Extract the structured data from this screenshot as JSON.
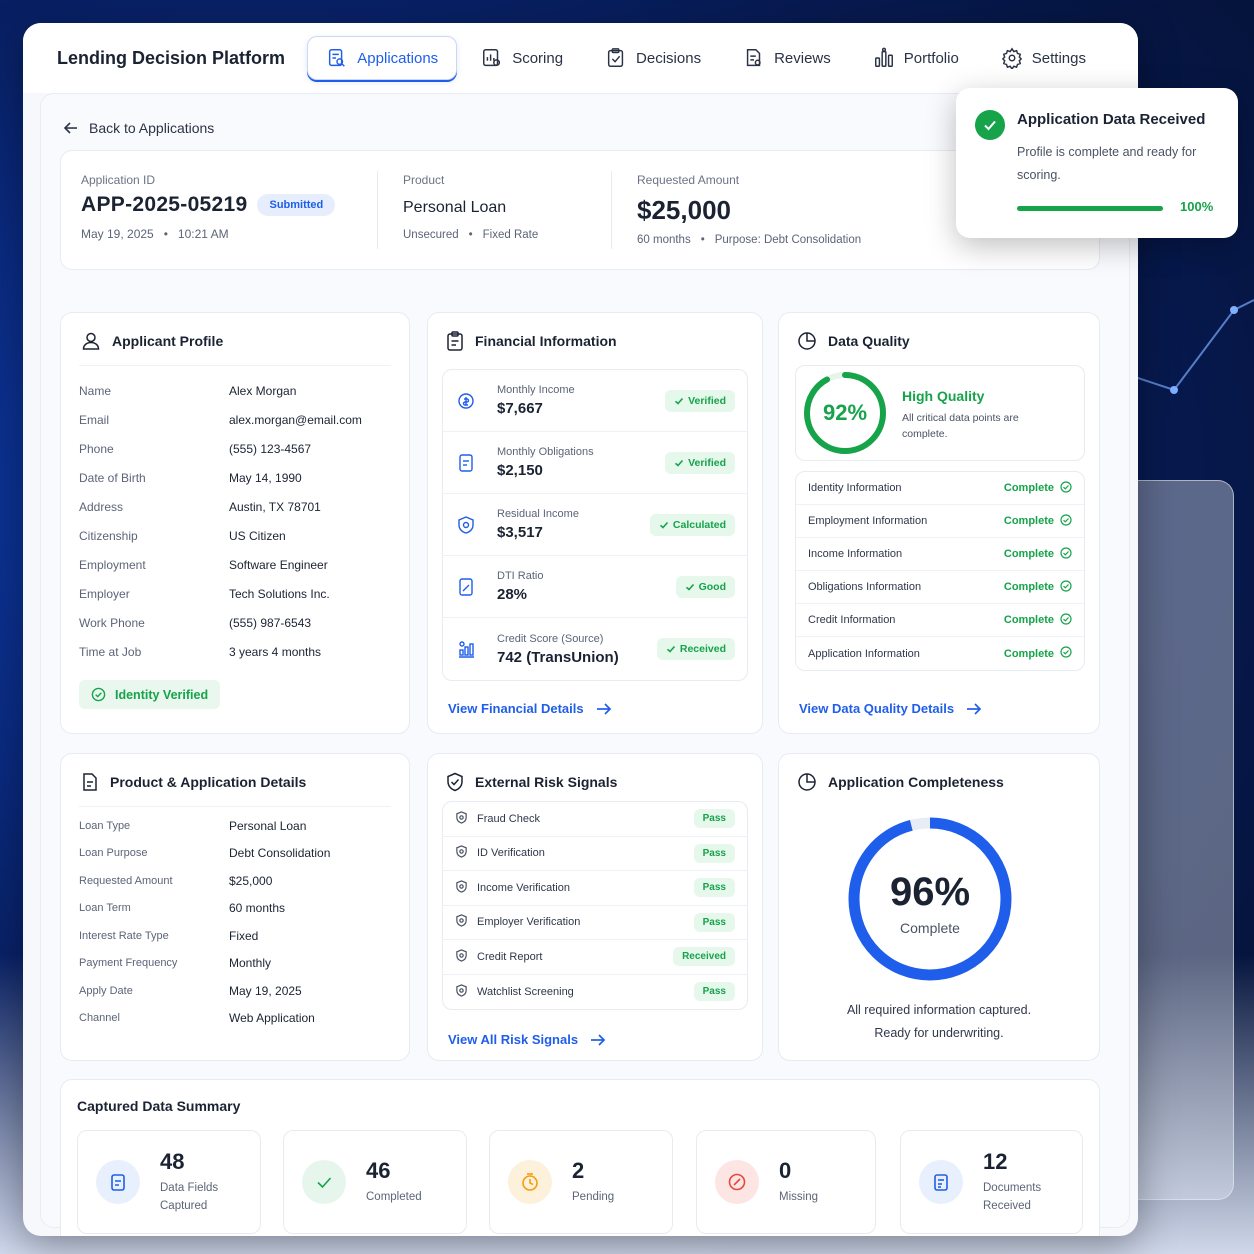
{
  "app": {
    "brand": "Lending Decision Platform",
    "nav": [
      {
        "label": "Applications",
        "icon": "applications-icon",
        "active": true
      },
      {
        "label": "Scoring",
        "icon": "scoring-icon"
      },
      {
        "label": "Decisions",
        "icon": "decisions-icon"
      },
      {
        "label": "Reviews",
        "icon": "reviews-icon"
      },
      {
        "label": "Portfolio",
        "icon": "portfolio-icon"
      },
      {
        "label": "Settings",
        "icon": "gear-icon"
      }
    ],
    "back_label": "Back to Applications"
  },
  "header": {
    "app_id_label": "Application ID",
    "app_id": "APP-2025-05219",
    "status": "Submitted",
    "date": "May 19, 2025",
    "time": "10:21 AM",
    "product_label": "Product",
    "product": "Personal Loan",
    "product_tag1": "Unsecured",
    "product_tag2": "Fixed Rate",
    "amount_label": "Requested Amount",
    "amount": "$25,000",
    "term": "60 months",
    "purpose": "Purpose: Debt Consolidation"
  },
  "toast": {
    "title": "Application Data Received",
    "message": "Profile is complete and ready for scoring.",
    "progress_percent": 100,
    "progress_label": "100%"
  },
  "applicant": {
    "title": "Applicant Profile",
    "rows": [
      {
        "k": "Name",
        "v": "Alex Morgan"
      },
      {
        "k": "Email",
        "v": "alex.morgan@email.com"
      },
      {
        "k": "Phone",
        "v": "(555) 123-4567"
      },
      {
        "k": "Date of Birth",
        "v": "May 14, 1990"
      },
      {
        "k": "Address",
        "v": "Austin, TX 78701"
      },
      {
        "k": "Citizenship",
        "v": "US Citizen"
      },
      {
        "k": "Employment",
        "v": "Software Engineer"
      },
      {
        "k": "Employer",
        "v": "Tech Solutions Inc."
      },
      {
        "k": "Work Phone",
        "v": "(555) 987-6543"
      },
      {
        "k": "Time at Job",
        "v": "3 years 4 months"
      }
    ],
    "badge": "Identity Verified"
  },
  "financial": {
    "title": "Financial Information",
    "rows": [
      {
        "label": "Monthly Income",
        "value": "$7,667",
        "status": "Verified",
        "icon": "income-icon"
      },
      {
        "label": "Monthly Obligations",
        "value": "$2,150",
        "status": "Verified",
        "icon": "obligations-icon"
      },
      {
        "label": "Residual Income",
        "value": "$3,517",
        "status": "Calculated",
        "icon": "residual-icon"
      },
      {
        "label": "DTI Ratio",
        "value": "28%",
        "status": "Good",
        "icon": "dti-icon"
      },
      {
        "label": "Credit Score (Source)",
        "value": "742 (TransUnion)",
        "status": "Received",
        "icon": "credit-score-icon"
      }
    ],
    "link": "View Financial Details"
  },
  "quality": {
    "title": "Data Quality",
    "score_label": "92%",
    "score_value": 92,
    "heading": "High Quality",
    "desc": "All critical data points are complete.",
    "rows": [
      {
        "label": "Identity Information",
        "status": "Complete"
      },
      {
        "label": "Employment Information",
        "status": "Complete"
      },
      {
        "label": "Income Information",
        "status": "Complete"
      },
      {
        "label": "Obligations Information",
        "status": "Complete"
      },
      {
        "label": "Credit Information",
        "status": "Complete"
      },
      {
        "label": "Application Information",
        "status": "Complete"
      }
    ],
    "link": "View Data Quality Details"
  },
  "product": {
    "title": "Product & Application Details",
    "rows": [
      {
        "k": "Loan Type",
        "v": "Personal Loan"
      },
      {
        "k": "Loan Purpose",
        "v": "Debt Consolidation"
      },
      {
        "k": "Requested Amount",
        "v": "$25,000"
      },
      {
        "k": "Loan Term",
        "v": "60 months"
      },
      {
        "k": "Interest Rate Type",
        "v": "Fixed"
      },
      {
        "k": "Payment Frequency",
        "v": "Monthly"
      },
      {
        "k": "Apply Date",
        "v": "May 19, 2025"
      },
      {
        "k": "Channel",
        "v": "Web Application"
      }
    ]
  },
  "risk": {
    "title": "External Risk Signals",
    "rows": [
      {
        "label": "Fraud Check",
        "status": "Pass"
      },
      {
        "label": "ID Verification",
        "status": "Pass"
      },
      {
        "label": "Income Verification",
        "status": "Pass"
      },
      {
        "label": "Employer Verification",
        "status": "Pass"
      },
      {
        "label": "Credit Report",
        "status": "Received"
      },
      {
        "label": "Watchlist Screening",
        "status": "Pass"
      }
    ],
    "link": "View All Risk Signals"
  },
  "completeness": {
    "title": "Application Completeness",
    "value": 96,
    "percent_label": "96%",
    "sub": "Complete",
    "line1": "All required information captured.",
    "line2": "Ready for underwriting."
  },
  "summary": {
    "title": "Captured Data Summary",
    "items": [
      {
        "num": "48",
        "label": "Data Fields Captured",
        "icon": "data-fields-icon",
        "color": "#1f5eea"
      },
      {
        "num": "46",
        "label": "Completed",
        "icon": "check-icon",
        "color": "#16a34a"
      },
      {
        "num": "2",
        "label": "Pending",
        "icon": "clock-icon",
        "color": "#f59e0b"
      },
      {
        "num": "0",
        "label": "Missing",
        "icon": "missing-icon",
        "color": "#e5483b"
      },
      {
        "num": "12",
        "label": "Documents Received",
        "icon": "documents-icon",
        "color": "#1f5eea"
      }
    ]
  },
  "colors": {
    "accent": "#1f5eea",
    "success": "#16a34a",
    "warning": "#f59e0b",
    "danger": "#e5483b"
  }
}
